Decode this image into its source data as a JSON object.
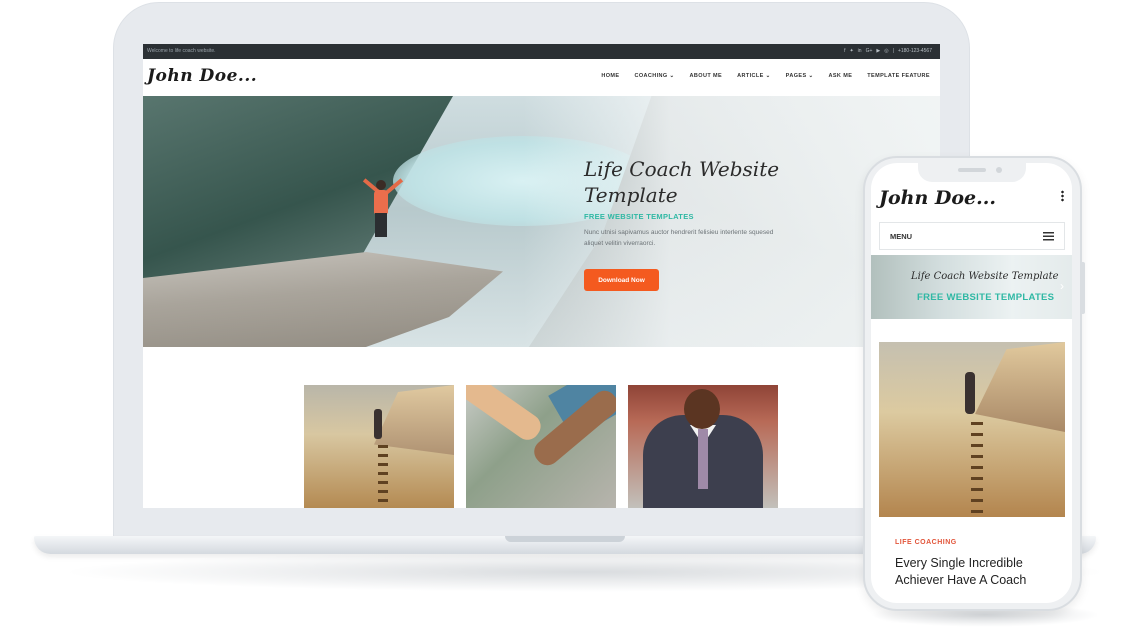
{
  "topbar": {
    "welcome": "Welcome to life coach website.",
    "social_icons": [
      "facebook-icon",
      "twitter-icon",
      "linkedin-icon",
      "google-plus-icon",
      "youtube-icon",
      "instagram-icon"
    ],
    "phone": "+180-123-4567"
  },
  "site": {
    "logo": "John Doe..."
  },
  "nav": {
    "items": [
      {
        "label": "HOME"
      },
      {
        "label": "COACHING ⌄"
      },
      {
        "label": "ABOUT ME"
      },
      {
        "label": "ARTICLE ⌄"
      },
      {
        "label": "PAGES ⌄"
      },
      {
        "label": "ASK ME"
      },
      {
        "label": "TEMPLATE FEATURE"
      }
    ]
  },
  "hero": {
    "title": "Life Coach Website Template",
    "subtitle": "FREE WEBSITE TEMPLATES",
    "description": "Nunc utnisi sapivamus auctor hendrerit felisieu interlente squesed aliquet velitin viverraorci.",
    "button": "Download Now"
  },
  "mobile": {
    "logo": "John Doe...",
    "menu_label": "MENU",
    "banner_title": "Life Coach Website Template",
    "banner_subtitle": "FREE WEBSITE TEMPLATES",
    "post_category": "LIFE COACHING",
    "post_title": "Every Single Incredible Achiever Have A Coach"
  },
  "colors": {
    "accent_teal": "#2fb8a4",
    "accent_orange": "#f45a1f",
    "topbar": "#2b3034"
  }
}
